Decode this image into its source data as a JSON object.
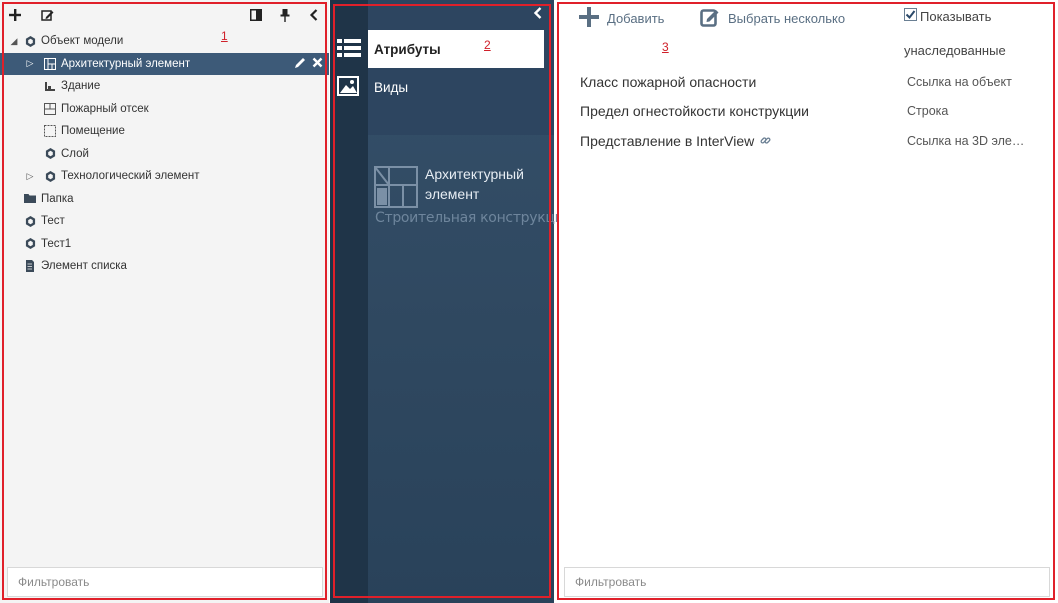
{
  "tree_panel": {
    "toolbar": {
      "add_icon": "plus-icon",
      "edit_icon": "edit-square-icon",
      "layout_icon": "panel-layout-icon",
      "pin_icon": "pin-icon",
      "collapse_icon": "chevron-left-icon"
    },
    "items": [
      {
        "label": "Объект модели",
        "icon": "hexagon-icon",
        "expanded": true
      },
      {
        "label": "Архитектурный элемент",
        "icon": "building-plan-icon",
        "selected": true
      },
      {
        "label": "Здание",
        "icon": "building-icon"
      },
      {
        "label": "Пожарный отсек",
        "icon": "fire-compartment-icon"
      },
      {
        "label": "Помещение",
        "icon": "room-icon"
      },
      {
        "label": "Слой",
        "icon": "hexagon-icon"
      },
      {
        "label": "Технологический элемент",
        "icon": "hexagon-icon",
        "expanded": false
      },
      {
        "label": "Папка",
        "icon": "folder-icon"
      },
      {
        "label": "Тест",
        "icon": "hexagon-icon"
      },
      {
        "label": "Тест1",
        "icon": "hexagon-icon"
      },
      {
        "label": "Элемент списка",
        "icon": "document-icon"
      }
    ],
    "filter_placeholder": "Фильтровать"
  },
  "nav_panel": {
    "tabs": [
      {
        "label": "Атрибуты",
        "icon": "list-icon",
        "active": true
      },
      {
        "label": "Виды",
        "icon": "image-icon",
        "active": false
      }
    ],
    "entity": {
      "title": "Архитектурный элемент",
      "subtitle": "Строительная конструкция",
      "icon": "building-plan-icon"
    },
    "collapse_icon": "chevron-left-icon"
  },
  "attrs_panel": {
    "toolbar": {
      "add_label": "Добавить",
      "multi_select_label": "Выбрать несколько",
      "show_inherited_label": "Показывать",
      "show_inherited_label_2": "унаследованные",
      "show_inherited_checked": true
    },
    "attributes": [
      {
        "name": "Класс пожарной опасности",
        "type": "Ссылка на объект",
        "link_icon": false
      },
      {
        "name": "Предел огнестойкости конструкции",
        "type": "Строка",
        "link_icon": false
      },
      {
        "name": "Представление в InterView",
        "type": "Ссылка на 3D элем...",
        "link_icon": true
      }
    ],
    "filter_placeholder": "Фильтровать"
  },
  "annotations": {
    "labels": [
      "1",
      "2",
      "3"
    ],
    "frame_color": "#e0202a"
  },
  "colors": {
    "selected_row": "#3d5a78",
    "nav_dark": "#2f4860",
    "nav_rail": "#1f3448",
    "toolbar_icon": "#5a6f83"
  }
}
